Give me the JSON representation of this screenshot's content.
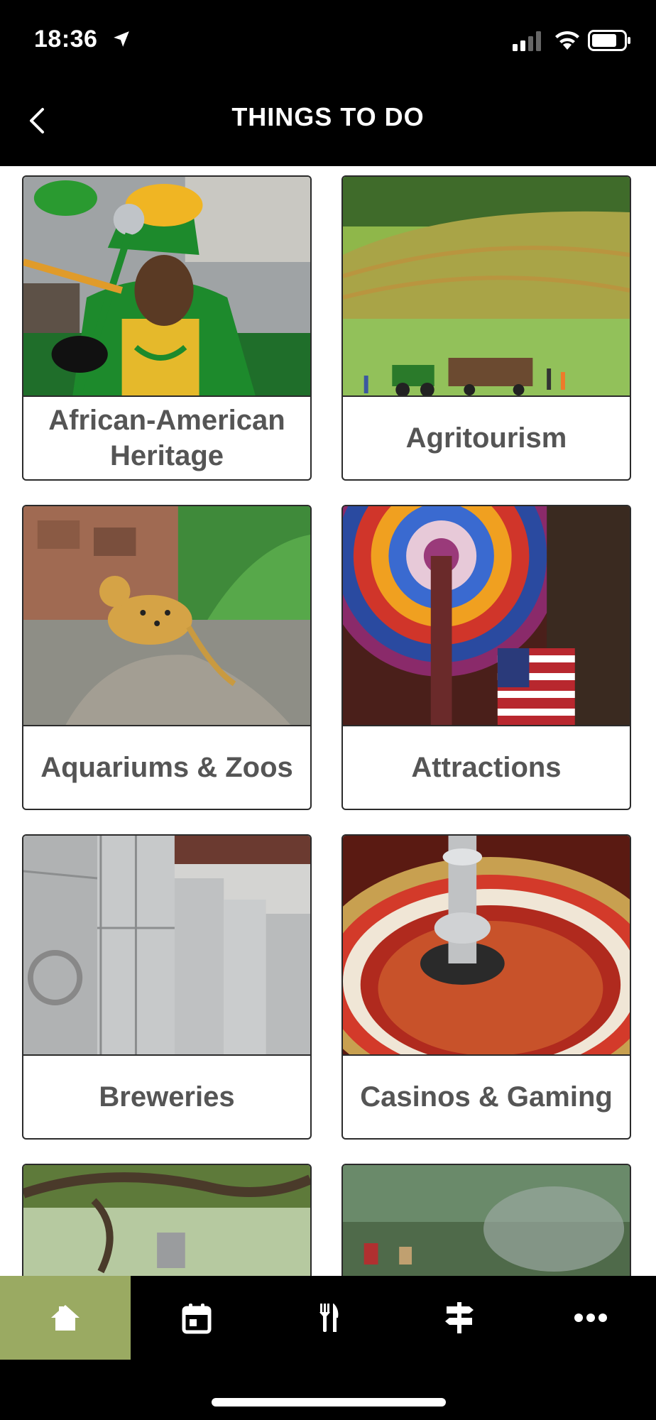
{
  "status": {
    "time": "18:36"
  },
  "header": {
    "title": "THINGS TO DO",
    "back_icon": "chevron-left-icon"
  },
  "categories": [
    {
      "label": "African-American Heritage"
    },
    {
      "label": "Agritourism"
    },
    {
      "label": "Aquariums & Zoos"
    },
    {
      "label": "Attractions"
    },
    {
      "label": "Breweries"
    },
    {
      "label": "Casinos & Gaming"
    },
    {
      "label": ""
    },
    {
      "label": ""
    }
  ],
  "tabs": [
    {
      "icon": "home-icon",
      "active": true
    },
    {
      "icon": "calendar-icon",
      "active": false
    },
    {
      "icon": "fork-knife-icon",
      "active": false
    },
    {
      "icon": "signpost-icon",
      "active": false
    },
    {
      "icon": "more-icon",
      "active": false
    }
  ],
  "colors": {
    "active_tab": "#9aaa62",
    "background": "#000000",
    "label_text": "#555555"
  }
}
